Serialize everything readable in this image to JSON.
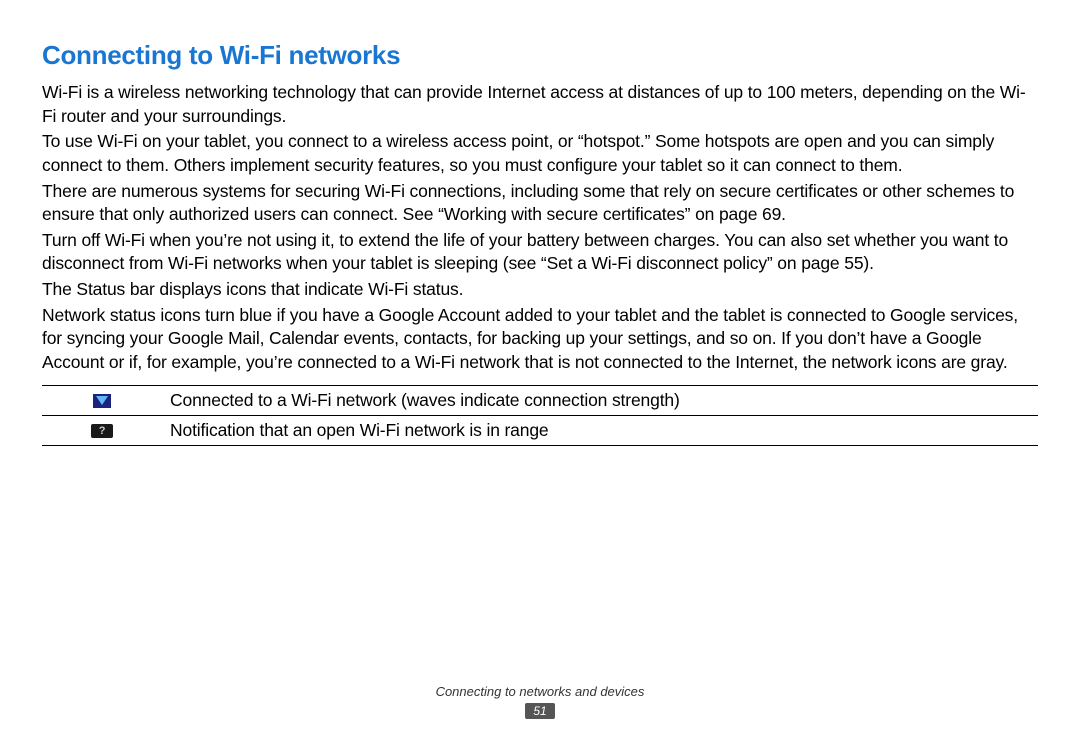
{
  "heading": "Connecting to Wi-Fi networks",
  "paragraphs": {
    "p1": "Wi-Fi is a wireless networking technology that can provide Internet access at distances of up to 100 meters, depending on the Wi-Fi router and your surroundings.",
    "p2": "To use Wi-Fi on your tablet, you connect to a wireless access point, or “hotspot.” Some hotspots are open and you can simply connect to them. Others implement security features, so you must configure your tablet so it can connect to them.",
    "p3": "There are numerous systems for securing Wi-Fi connections, including some that rely on secure certificates or other schemes to ensure that only authorized users can connect. See “Working with secure certificates” on page 69.",
    "p4": "Turn off Wi-Fi when you’re not using it, to extend the life of your battery between charges. You can also set whether you want to disconnect from Wi-Fi networks when your tablet is sleeping (see “Set a Wi-Fi disconnect policy” on page 55).",
    "p5": "The Status bar displays icons that indicate Wi-Fi status.",
    "p6": "Network status icons turn blue if you have a Google Account added to your tablet and the tablet is connected to Google services, for syncing your Google Mail, Calendar events, contacts, for backing up your settings, and so on. If you don’t have a Google Account or if, for example, you’re connected to a Wi-Fi network that is not connected to the Internet, the network icons are gray."
  },
  "status_rows": {
    "row1": "Connected to a Wi-Fi network (waves indicate connection strength)",
    "row2": "Notification that an open Wi-Fi network is in range"
  },
  "footer": {
    "section": "Connecting to networks and devices",
    "page": "51"
  }
}
